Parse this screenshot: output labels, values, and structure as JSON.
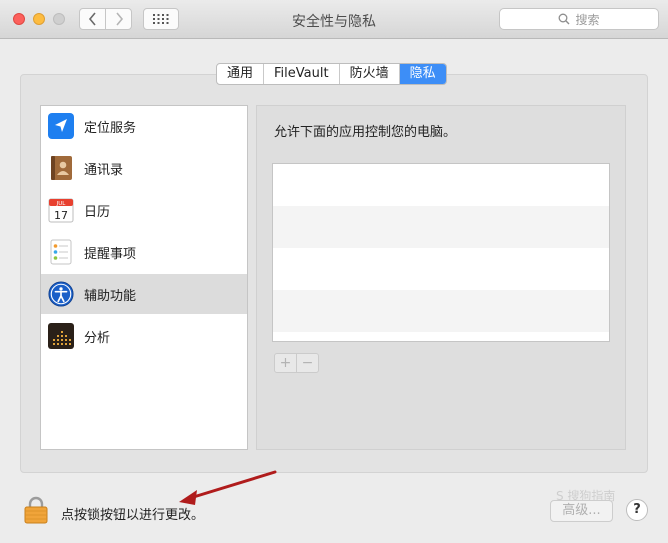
{
  "window": {
    "title": "安全性与隐私"
  },
  "toolbar": {
    "search_placeholder": "搜索"
  },
  "tabs": [
    {
      "label": "通用",
      "active": false
    },
    {
      "label": "FileVault",
      "active": false
    },
    {
      "label": "防火墙",
      "active": false
    },
    {
      "label": "隐私",
      "active": true
    }
  ],
  "sidebar": {
    "items": [
      {
        "label": "定位服务",
        "icon": "location-arrow-icon",
        "selected": false
      },
      {
        "label": "通讯录",
        "icon": "contacts-book-icon",
        "selected": false
      },
      {
        "label": "日历",
        "icon": "calendar-icon",
        "selected": false,
        "icon_month": "JUL",
        "icon_day": "17"
      },
      {
        "label": "提醒事项",
        "icon": "reminders-list-icon",
        "selected": false
      },
      {
        "label": "辅助功能",
        "icon": "accessibility-icon",
        "selected": true
      },
      {
        "label": "分析",
        "icon": "analytics-icon",
        "selected": false
      }
    ]
  },
  "main": {
    "description": "允许下面的应用控制您的电脑。",
    "add_label": "+",
    "remove_label": "−"
  },
  "footer": {
    "lock_text": "点按锁按钮以进行更改。",
    "advanced_label": "高级...",
    "help_label": "?",
    "watermark": "S 搜狗指南"
  },
  "colors": {
    "accent": "#3d8ef7",
    "annotation_arrow": "#b01c1c"
  }
}
